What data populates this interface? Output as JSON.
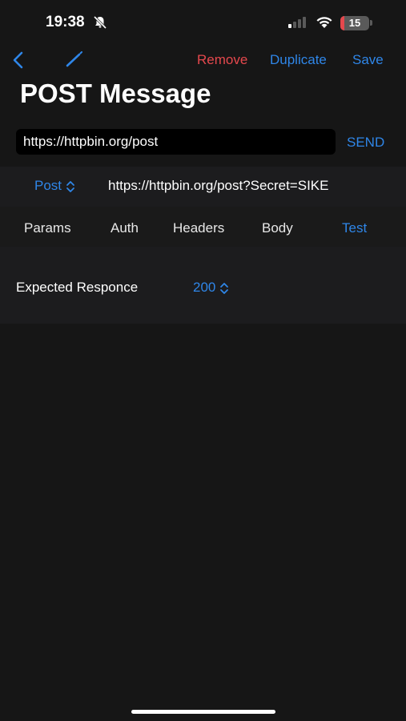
{
  "status_bar": {
    "time": "19:38",
    "battery_level": "15",
    "battery_fraction": 0.15,
    "icons": [
      "bell-slash-icon",
      "signal-icon",
      "wifi-icon",
      "battery-icon"
    ]
  },
  "nav": {
    "back_icon": "chevron-left-icon",
    "edit_icon": "pencil-icon",
    "remove_label": "Remove",
    "duplicate_label": "Duplicate",
    "save_label": "Save"
  },
  "page_title": "POST Message",
  "request": {
    "url_value": "https://httpbin.org/post",
    "send_label": "SEND",
    "method": "Post",
    "full_url": "https://httpbin.org/post?Secret=SIKE"
  },
  "tabs": [
    {
      "label": "Params",
      "active": false
    },
    {
      "label": "Auth",
      "active": false
    },
    {
      "label": "Headers",
      "active": false
    },
    {
      "label": "Body",
      "active": false
    },
    {
      "label": "Test",
      "active": true
    }
  ],
  "test": {
    "expected_label": "Expected Responce",
    "expected_value": "200"
  },
  "colors": {
    "accent": "#2f86e8",
    "destructive": "#e5484d",
    "background": "#161616"
  }
}
